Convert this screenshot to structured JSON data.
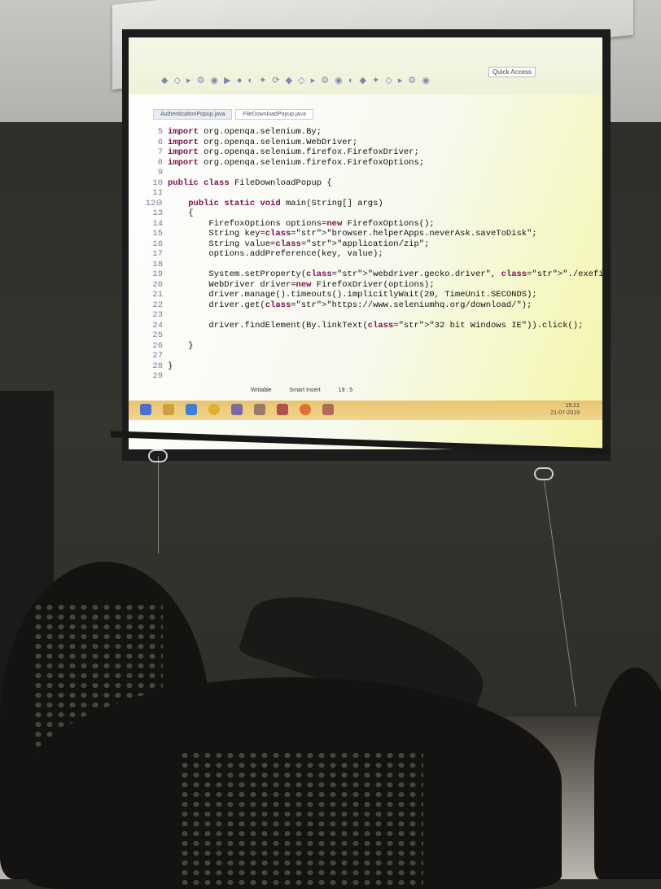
{
  "ide": {
    "quick_access": "Quick Access",
    "tabs": [
      "AuthenticationPopup.java",
      "FileDownloadPopup.java"
    ],
    "status": [
      "Writable",
      "Smart Insert",
      "19 : 5"
    ],
    "tray_time": "15:21",
    "tray_date": "21-07-2019"
  },
  "code_lines": [
    {
      "n": "5",
      "t": "import org.openqa.selenium.By;"
    },
    {
      "n": "6",
      "t": "import org.openqa.selenium.WebDriver;"
    },
    {
      "n": "7",
      "t": "import org.openqa.selenium.firefox.FirefoxDriver;"
    },
    {
      "n": "8",
      "t": "import org.openqa.selenium.firefox.FirefoxOptions;"
    },
    {
      "n": "9",
      "t": ""
    },
    {
      "n": "10",
      "t": "public class FileDownloadPopup {"
    },
    {
      "n": "11",
      "t": ""
    },
    {
      "n": "12⊖",
      "t": "    public static void main(String[] args)"
    },
    {
      "n": "13",
      "t": "    {"
    },
    {
      "n": "14",
      "t": "        FirefoxOptions options=new FirefoxOptions();"
    },
    {
      "n": "15",
      "t": "        String key=\"browser.helperApps.neverAsk.saveToDisk\";"
    },
    {
      "n": "16",
      "t": "        String value=\"application/zip\";"
    },
    {
      "n": "17",
      "t": "        options.addPreference(key, value);"
    },
    {
      "n": "18",
      "t": ""
    },
    {
      "n": "19",
      "t": "        System.setProperty(\"webdriver.gecko.driver\", \"./exefiles/geckodriver.exe\");"
    },
    {
      "n": "20",
      "t": "        WebDriver driver=new FirefoxDriver(options);"
    },
    {
      "n": "21",
      "t": "        driver.manage().timeouts().implicitlyWait(20, TimeUnit.SECONDS);"
    },
    {
      "n": "22",
      "t": "        driver.get(\"https://www.seleniumhq.org/download/\");"
    },
    {
      "n": "23",
      "t": ""
    },
    {
      "n": "24",
      "t": "        driver.findElement(By.linkText(\"32 bit Windows IE\")).click();"
    },
    {
      "n": "25",
      "t": ""
    },
    {
      "n": "26",
      "t": "    }"
    },
    {
      "n": "27",
      "t": ""
    },
    {
      "n": "28",
      "t": "}"
    },
    {
      "n": "29",
      "t": ""
    }
  ],
  "colors": {
    "keyword": "#7d0f4f",
    "string": "#2a3ad0",
    "taskbar": "#e9c46f"
  }
}
